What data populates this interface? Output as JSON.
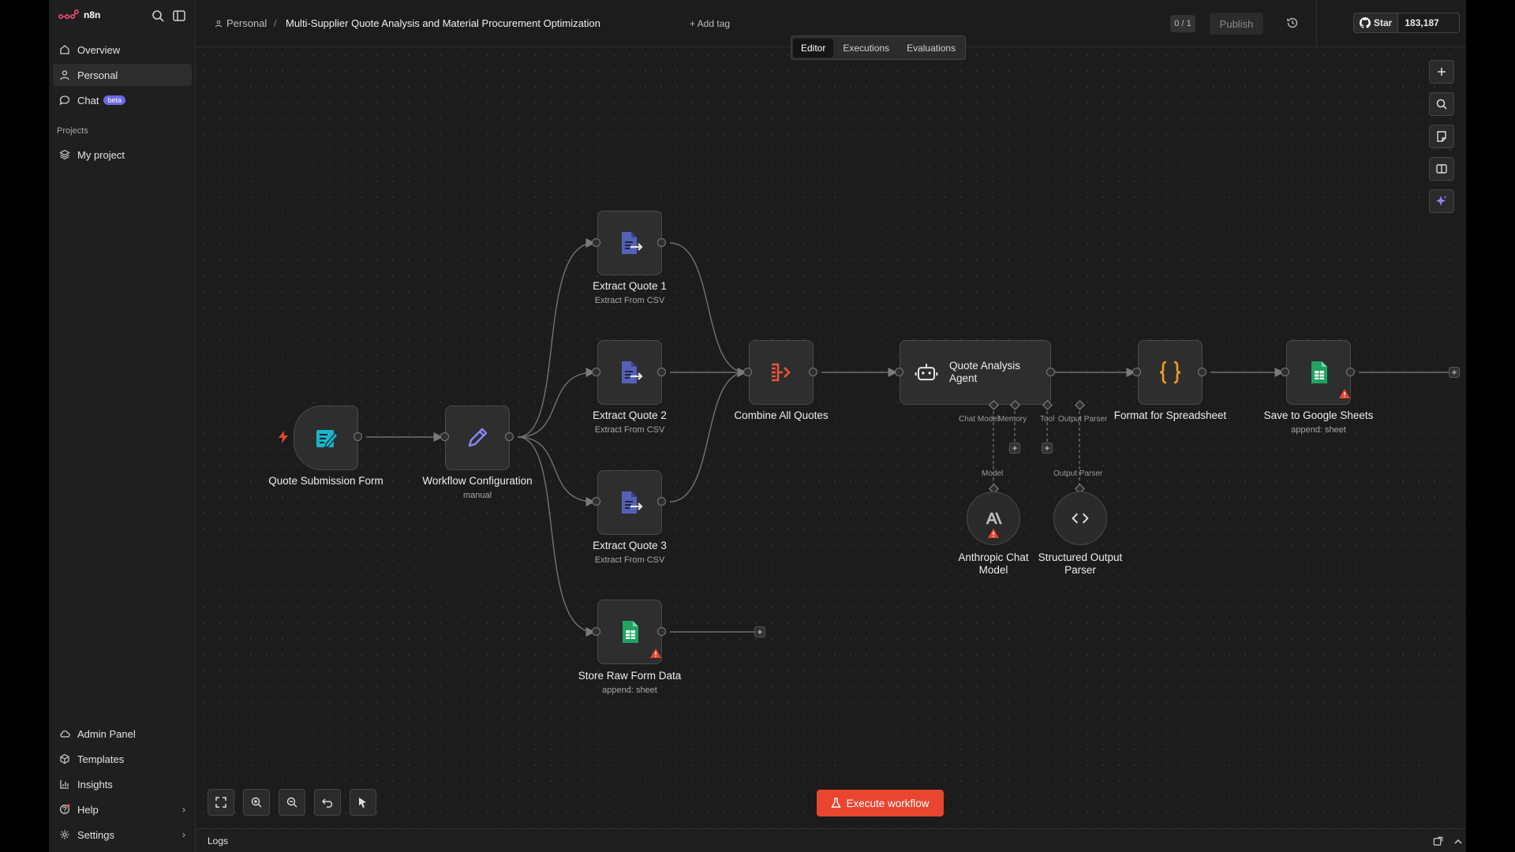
{
  "app": {
    "name": "n8n"
  },
  "sidebar": {
    "items": [
      {
        "label": "Overview",
        "icon": "home-icon"
      },
      {
        "label": "Personal",
        "icon": "user-icon"
      },
      {
        "label": "Chat",
        "icon": "chat-icon",
        "badge": "beta"
      }
    ],
    "projects_label": "Projects",
    "projects": [
      {
        "label": "My project",
        "icon": "layers-icon"
      }
    ],
    "bottom": [
      {
        "label": "Admin Panel",
        "icon": "cloud-icon"
      },
      {
        "label": "Templates",
        "icon": "templates-icon"
      },
      {
        "label": "Insights",
        "icon": "chart-icon"
      },
      {
        "label": "Help",
        "icon": "help-icon"
      },
      {
        "label": "Settings",
        "icon": "gear-icon"
      }
    ]
  },
  "header": {
    "breadcrumb_project": "Personal",
    "breadcrumb_sep": "/",
    "workflow_title": "Multi-Supplier Quote Analysis and Material Procurement Optimization",
    "add_tag": "+ Add tag",
    "counter": "0 / 1",
    "publish_label": "Publish",
    "star_label": "Star",
    "star_count": "183,187"
  },
  "tabs": [
    {
      "label": "Editor",
      "active": true
    },
    {
      "label": "Executions",
      "active": false
    },
    {
      "label": "Evaluations",
      "active": false
    }
  ],
  "nodes": {
    "form": {
      "label": "Quote Submission Form"
    },
    "config": {
      "label": "Workflow Configuration",
      "sub": "manual"
    },
    "extract1": {
      "label": "Extract Quote 1",
      "sub": "Extract From CSV"
    },
    "extract2": {
      "label": "Extract Quote 2",
      "sub": "Extract From CSV"
    },
    "extract3": {
      "label": "Extract Quote 3",
      "sub": "Extract From CSV"
    },
    "store": {
      "label": "Store Raw Form Data",
      "sub": "append: sheet"
    },
    "combine": {
      "label": "Combine All Quotes"
    },
    "agent": {
      "label_line1": "Quote Analysis",
      "label_line2": "Agent",
      "ports": {
        "chat_model": "Chat Model",
        "memory": "Memory",
        "tool": "Tool",
        "output_parser": "Output Parser"
      }
    },
    "anthropic": {
      "label_line1": "Anthropic Chat",
      "label_line2": "Model",
      "port_label": "Model"
    },
    "parser": {
      "label_line1": "Structured Output",
      "label_line2": "Parser",
      "port_label": "Output Parser"
    },
    "format": {
      "label": "Format for Spreadsheet"
    },
    "sheets": {
      "label": "Save to Google Sheets",
      "sub": "append: sheet"
    }
  },
  "execute_label": "Execute workflow",
  "logs_label": "Logs",
  "colors": {
    "accent": "#e9452f",
    "brand": "#ea4b71",
    "doc": "#5561b8",
    "sheets": "#1fa463",
    "code": "#f39c20",
    "form": "#1ab5c6"
  }
}
